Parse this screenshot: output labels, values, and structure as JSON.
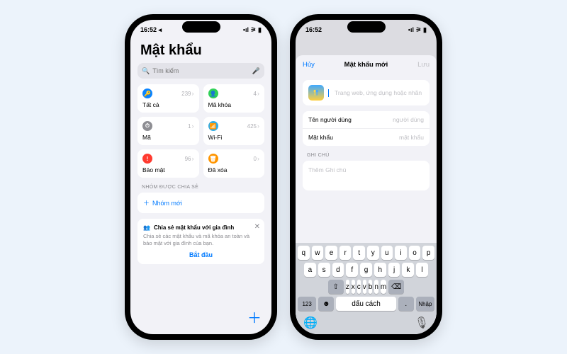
{
  "statusbar": {
    "time": "16:52",
    "loc_icon": "◀"
  },
  "left": {
    "title": "Mật khẩu",
    "search_placeholder": "Tìm kiếm",
    "tiles": [
      {
        "label": "Tất cả",
        "count": "239",
        "color": "#0a84ff",
        "glyph": "🔑"
      },
      {
        "label": "Mã khóa",
        "count": "4",
        "color": "#30d158",
        "glyph": "👤"
      },
      {
        "label": "Mã",
        "count": "1",
        "color": "#8e8e93",
        "glyph": "⏱"
      },
      {
        "label": "Wi-Fi",
        "count": "425",
        "color": "#32ade6",
        "glyph": "📶"
      },
      {
        "label": "Bảo mật",
        "count": "96",
        "color": "#ff3b30",
        "glyph": "!"
      },
      {
        "label": "Đã xóa",
        "count": "0",
        "color": "#ff9500",
        "glyph": "🗑"
      }
    ],
    "shared_section": "NHÓM ĐƯỢC CHIA SẺ",
    "new_group": "Nhóm mới",
    "family": {
      "title": "Chia sẻ mật khẩu với gia đình",
      "desc": "Chia sẻ các mật khẩu và mã khóa an toàn và bảo mật với gia đình của bạn.",
      "start": "Bắt đầu"
    }
  },
  "right": {
    "cancel": "Hủy",
    "title": "Mật khẩu mới",
    "save": "Lưu",
    "site_placeholder": "Trang web, ứng dụng hoặc nhãn",
    "username_label": "Tên người dùng",
    "username_ph": "người dùng",
    "password_label": "Mật khẩu",
    "password_ph": "mật khẩu",
    "notes_section": "GHI CHÚ",
    "notes_ph": "Thêm Ghi chú",
    "keyboard": {
      "r1": [
        "q",
        "w",
        "e",
        "r",
        "t",
        "y",
        "u",
        "i",
        "o",
        "p"
      ],
      "r2": [
        "a",
        "s",
        "d",
        "f",
        "g",
        "h",
        "j",
        "k",
        "l"
      ],
      "r3": [
        "z",
        "x",
        "c",
        "v",
        "b",
        "n",
        "m"
      ],
      "shift": "⇧",
      "bksp": "⌫",
      "numkey": "123",
      "space": "dấu cách",
      "dot": ".",
      "enter": "Nhập"
    }
  }
}
